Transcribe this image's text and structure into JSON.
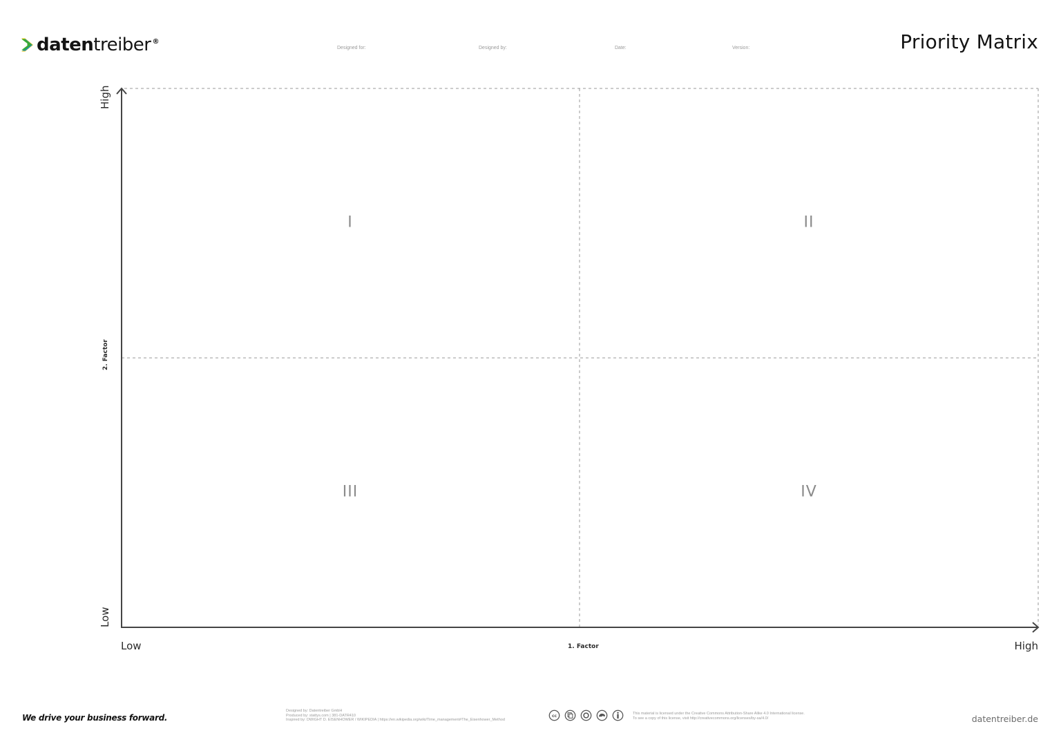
{
  "header": {
    "logo": {
      "text_regular_1": "daten",
      "text_bold": "",
      "text_regular_2": "treiber",
      "registered": "®",
      "colors": {
        "green": "#3aaa35",
        "yellow": "#f2c500",
        "blue": "#0a8bd0"
      }
    },
    "meta_labels": {
      "designed_for": "Designed for:",
      "designed_by": "Designed by:",
      "date": "Date:",
      "version": "Version:"
    },
    "title": "Priority Matrix"
  },
  "matrix": {
    "y_axis": {
      "high": "High",
      "low": "Low",
      "label": "2. Factor"
    },
    "x_axis": {
      "low": "Low",
      "high": "High",
      "label": "1. Factor"
    },
    "quadrants": [
      {
        "id": "I",
        "label": "I"
      },
      {
        "id": "II",
        "label": "II"
      },
      {
        "id": "III",
        "label": "III"
      },
      {
        "id": "IV",
        "label": "IV"
      }
    ],
    "colors": {
      "axis": "#444444",
      "dashed": "#9a9a9a",
      "quadrant_text": "#8a8a8a"
    }
  },
  "footer": {
    "tagline": "We drive your business forward.",
    "credits": [
      "Designed by: Datentreiber GmbH",
      "Produced by: stattys.com | 381-DATR410",
      "Inspired by: DWIGHT D. EISENHOWER / WIKIPEDIA | https://en.wikipedia.org/wiki/Time_management#The_Eisenhower_Method"
    ],
    "cc_icons": [
      "cc-icon",
      "attribution-icon",
      "share-alike-icon",
      "noncommercial-icon",
      "person-icon"
    ],
    "license": [
      "This material is licensed under the Creative Commons Attribution-Share Alike 4.0 International license.",
      "To see a copy of this license, visit http://creativecommons.org/licenses/by-sa/4.0/"
    ],
    "website": "datentreiber.de"
  }
}
